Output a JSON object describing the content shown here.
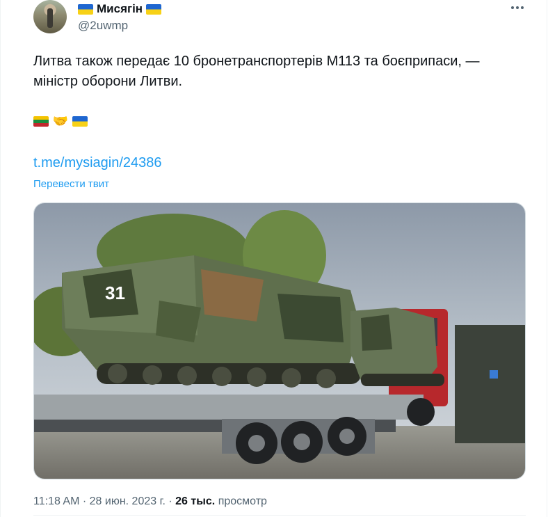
{
  "author": {
    "display_name": "Мисягін",
    "handle": "@2uwmp",
    "avatar_icon": "avatar-photo",
    "flag_icon": "ukraine-flag-icon"
  },
  "tweet": {
    "text": "Литва також передає 10 бронетранспортерів М113 та боєприпаси, — міністр оборони Литви.",
    "emojis": [
      "lithuania-flag-icon",
      "handshake-icon",
      "ukraine-flag-icon"
    ],
    "link": "t.me/mysiagin/24386",
    "translate_label": "Перевести твит"
  },
  "media": {
    "description_icon": "photo-m113-apcs-on-trailer",
    "vehicle_number": "31"
  },
  "meta": {
    "time": "11:18 AM",
    "separator": " · ",
    "date": "28 июн. 2023 г.",
    "views_count": "26 тыс.",
    "views_label": "просмотр"
  },
  "colors": {
    "link": "#1d9bf0",
    "secondary_text": "#536471",
    "primary_text": "#0f1419",
    "border": "#eff3f4"
  }
}
